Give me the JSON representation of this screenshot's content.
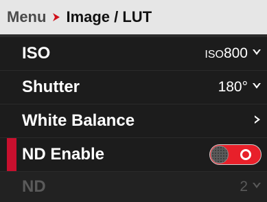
{
  "header": {
    "root": "Menu",
    "separator_icon": "chevron-right-icon",
    "current": "Image / LUT",
    "accent_color": "#d0101a"
  },
  "rows": [
    {
      "label": "ISO",
      "value_prefix": "ISO",
      "value": "800",
      "icon": "chevron-down-icon"
    },
    {
      "label": "Shutter",
      "value": "180°",
      "icon": "chevron-down-icon"
    },
    {
      "label": "White Balance",
      "icon": "chevron-right-icon"
    },
    {
      "label": "ND Enable",
      "toggle": "on",
      "active": true,
      "active_color": "#c8102e"
    },
    {
      "label": "ND",
      "value": "2",
      "icon": "chevron-down-icon",
      "disabled": true
    }
  ]
}
